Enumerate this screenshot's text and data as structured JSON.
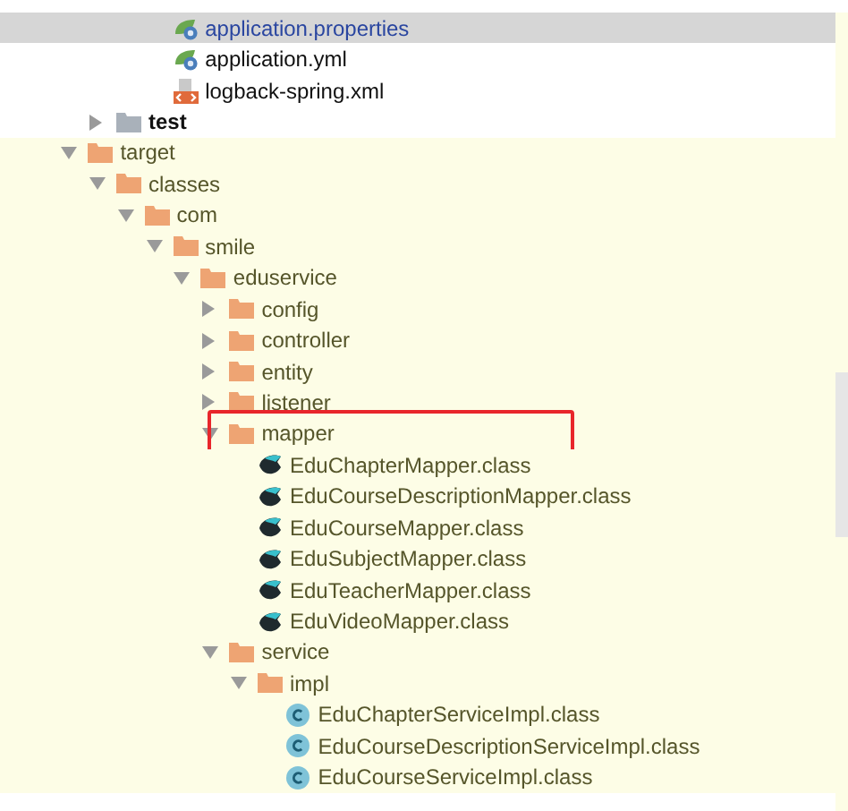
{
  "tree": [
    {
      "children": [
        {
          "children": [
            {
              "children": [
                {
                  "label": "application.properties",
                  "kind": "spring-config",
                  "selected": true
                },
                {
                  "label": "application.yml",
                  "kind": "spring-config",
                  "selected": false
                },
                {
                  "label": "logback-spring.xml",
                  "kind": "xml",
                  "selected": false
                }
              ]
            }
          ]
        },
        {
          "label": "test",
          "kind": "folder",
          "color": "#a9b1ba",
          "expanded": false,
          "selected": false
        }
      ]
    },
    {
      "label": "target",
      "kind": "folder",
      "color": "#eea473",
      "expanded": true,
      "excluded": true,
      "selected": false,
      "children": [
        {
          "label": "classes",
          "kind": "folder",
          "color": "#eea473",
          "expanded": true,
          "selected": false,
          "children": [
            {
              "label": "com",
              "kind": "folder",
              "color": "#eea473",
              "expanded": true,
              "selected": false,
              "children": [
                {
                  "label": "smile",
                  "kind": "folder",
                  "color": "#eea473",
                  "expanded": true,
                  "selected": false,
                  "children": [
                    {
                      "label": "eduservice",
                      "kind": "folder",
                      "color": "#eea473",
                      "expanded": true,
                      "selected": false,
                      "children": [
                        {
                          "label": "config",
                          "kind": "folder",
                          "color": "#eea473",
                          "expanded": false,
                          "selected": false
                        },
                        {
                          "label": "controller",
                          "kind": "folder",
                          "color": "#eea473",
                          "expanded": false,
                          "selected": false
                        },
                        {
                          "label": "entity",
                          "kind": "folder",
                          "color": "#eea473",
                          "expanded": false,
                          "selected": false
                        },
                        {
                          "label": "listener",
                          "kind": "folder",
                          "color": "#eea473",
                          "expanded": false,
                          "selected": false
                        },
                        {
                          "label": "mapper",
                          "kind": "folder",
                          "color": "#eea473",
                          "expanded": true,
                          "highlighted": true,
                          "selected": false,
                          "children": [
                            {
                              "label": "EduChapterMapper.class",
                              "kind": "mapper-class",
                              "selected": false
                            },
                            {
                              "label": "EduCourseDescriptionMapper.class",
                              "kind": "mapper-class",
                              "selected": false
                            },
                            {
                              "label": "EduCourseMapper.class",
                              "kind": "mapper-class",
                              "selected": false
                            },
                            {
                              "label": "EduSubjectMapper.class",
                              "kind": "mapper-class",
                              "selected": false
                            },
                            {
                              "label": "EduTeacherMapper.class",
                              "kind": "mapper-class",
                              "selected": false
                            },
                            {
                              "label": "EduVideoMapper.class",
                              "kind": "mapper-class",
                              "selected": false
                            }
                          ]
                        },
                        {
                          "label": "service",
                          "kind": "folder",
                          "color": "#eea473",
                          "expanded": true,
                          "selected": false,
                          "children": [
                            {
                              "label": "impl",
                              "kind": "folder",
                              "color": "#eea473",
                              "expanded": true,
                              "selected": false,
                              "children": [
                                {
                                  "label": "EduChapterServiceImpl.class",
                                  "kind": "class",
                                  "selected": false
                                },
                                {
                                  "label": "EduCourseDescriptionServiceImpl.class",
                                  "kind": "class",
                                  "selected": false
                                },
                                {
                                  "label": "EduCourseServiceImpl.class",
                                  "kind": "class",
                                  "selected": false
                                }
                              ]
                            }
                          ]
                        }
                      ]
                    }
                  ]
                }
              ]
            }
          ]
        }
      ]
    }
  ]
}
